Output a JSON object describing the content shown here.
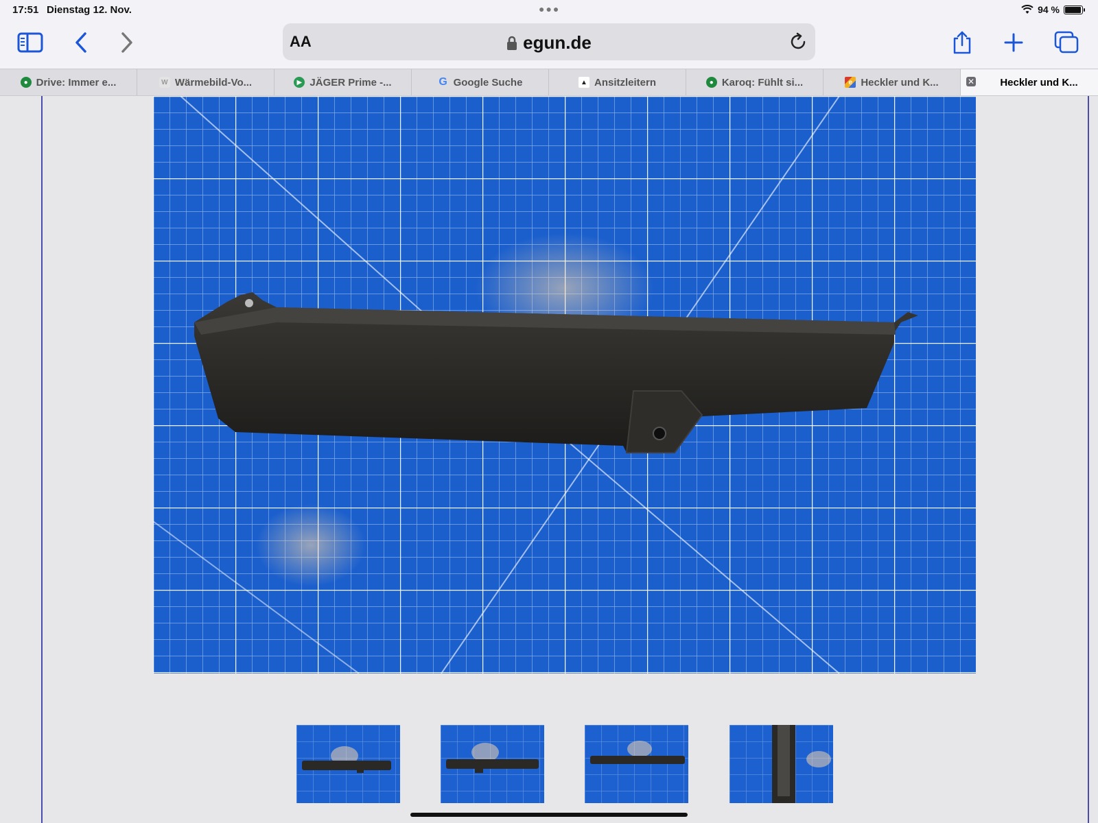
{
  "status": {
    "time": "17:51",
    "date": "Dienstag 12. Nov.",
    "battery": "94 %",
    "battery_level": 0.94
  },
  "toolbar": {
    "reader_label": "AA",
    "url": "egun.de"
  },
  "tabs": [
    {
      "label": "Drive: Immer e...",
      "favicon": "skoda-icon",
      "color": "#1f8a3d"
    },
    {
      "label": "Wärmebild-Vo...",
      "favicon": "w-icon",
      "color": "#b5b5b5"
    },
    {
      "label": "JÄGER Prime -...",
      "favicon": "play-icon",
      "color": "#2a9a55"
    },
    {
      "label": "Google Suche",
      "favicon": "google-icon",
      "color": "#4285f4"
    },
    {
      "label": "Ansitzleitern",
      "favicon": "hunter-icon",
      "color": "#333333"
    },
    {
      "label": "Karoq: Fühlt si...",
      "favicon": "skoda-icon",
      "color": "#1f8a3d"
    },
    {
      "label": "Heckler und K...",
      "favicon": "egun-icon",
      "color": "#d83a2b"
    },
    {
      "label": "Heckler und K...",
      "favicon": "close-icon",
      "active": true
    }
  ],
  "colors": {
    "mat_blue": "#1a5bc9",
    "accent": "#1a56d6",
    "border": "#4b4ba8"
  }
}
